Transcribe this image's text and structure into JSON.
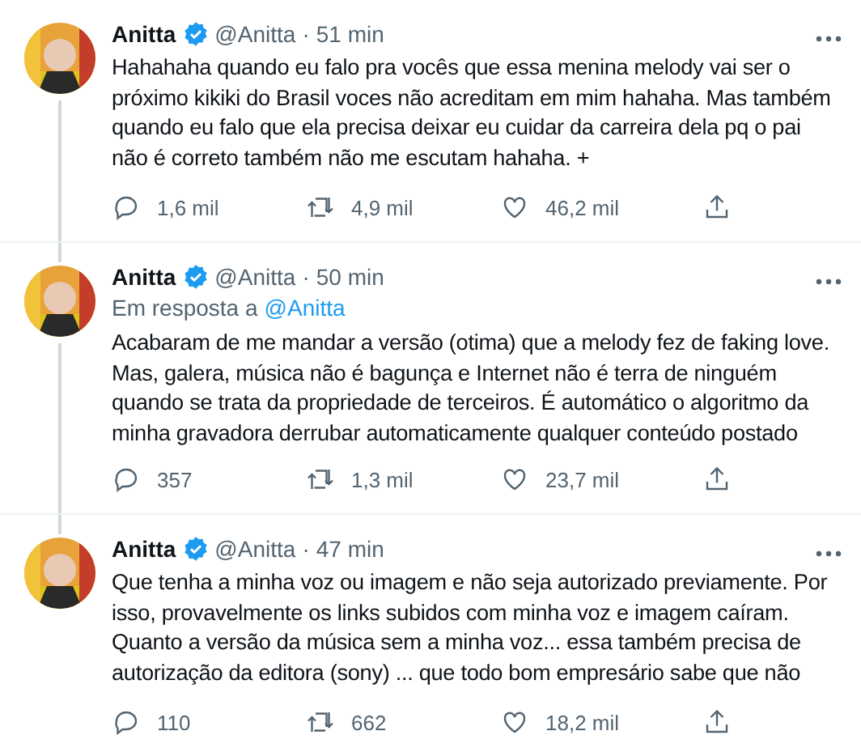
{
  "tweets": [
    {
      "name": "Anitta",
      "handle": "@Anitta",
      "separator": "·",
      "time": "51 min",
      "verified": true,
      "thread_above": false,
      "thread_below": true,
      "lines": [
        "Hahahaha quando eu falo pra vocês que essa menina melody vai ser o",
        "próximo kikiki do Brasil voces não acreditam em mim hahaha. Mas também",
        "quando eu falo que ela precisa deixar eu cuidar da carreira dela pq o pai",
        "não é correto também não me escutam hahaha. +"
      ],
      "replies": "1,6 mil",
      "retweets": "4,9 mil",
      "likes": "46,2 mil"
    },
    {
      "name": "Anitta",
      "handle": "@Anitta",
      "separator": "·",
      "time": "50 min",
      "verified": true,
      "thread_above": true,
      "thread_below": true,
      "reply_to": {
        "label": "Em resposta a",
        "handle": "@Anitta"
      },
      "lines": [
        "Acabaram de me mandar a versão (otima) que a melody fez de faking love.",
        "Mas, galera, música não é bagunça e Internet não é terra de ninguém",
        "quando se trata da propriedade de terceiros. É automático o algoritmo da",
        "minha gravadora derrubar automaticamente qualquer conteúdo postado"
      ],
      "replies": "357",
      "retweets": "1,3 mil",
      "likes": "23,7 mil"
    },
    {
      "name": "Anitta",
      "handle": "@Anitta",
      "separator": "·",
      "time": "47 min",
      "verified": true,
      "thread_above": true,
      "thread_below": false,
      "lines": [
        "Que tenha a minha voz ou imagem e não seja autorizado previamente. Por",
        "isso, provavelmente os links subidos com minha voz e imagem caíram.",
        "Quanto a versão da música sem a minha voz... essa também precisa de",
        "autorização da editora (sony) ... que todo bom empresário sabe que não"
      ],
      "replies": "110",
      "retweets": "662",
      "likes": "18,2 mil"
    }
  ]
}
